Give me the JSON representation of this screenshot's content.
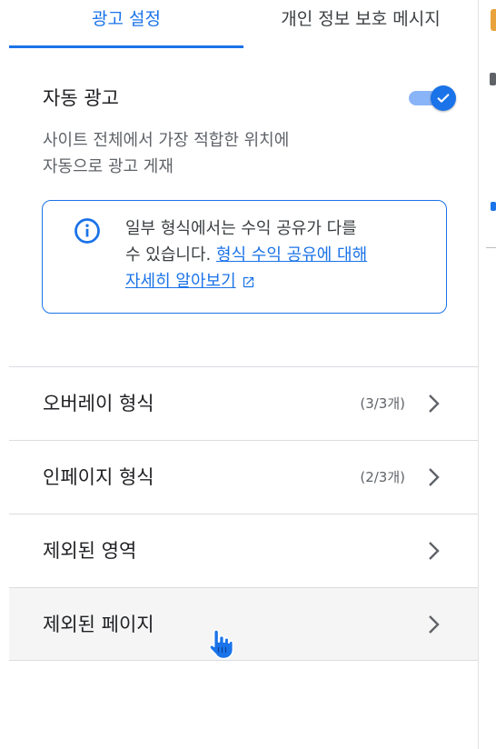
{
  "tabs": {
    "ad_settings": "광고 설정",
    "privacy_messages": "개인 정보 보호 메시지"
  },
  "auto_ads": {
    "title": "자동 광고",
    "toggle_on": true,
    "desc_line1": "사이트 전체에서 가장 적합한 위치에",
    "desc_line2": "자동으로 광고 게재"
  },
  "info": {
    "icon": "info-icon",
    "text_line1": "일부 형식에서는 수익 공유가 다를",
    "text_line2_prefix": "수 있습니다. ",
    "link_part1": "형식 수익 공유에 대해",
    "link_part2": "자세히 알아보기",
    "link_icon": "open-in-new-icon"
  },
  "list": {
    "items": [
      {
        "label": "오버레이 형식",
        "count": "(3/3개)"
      },
      {
        "label": "인페이지 형식",
        "count": "(2/3개)"
      },
      {
        "label": "제외된 영역",
        "count": ""
      },
      {
        "label": "제외된 페이지",
        "count": ""
      }
    ]
  },
  "colors": {
    "accent": "#1a73e8",
    "toggle_track": "#8ab4f8",
    "text_primary": "#202124",
    "text_secondary": "#5f6368",
    "divider": "#dadce0",
    "hover_row": "#f5f5f5"
  }
}
